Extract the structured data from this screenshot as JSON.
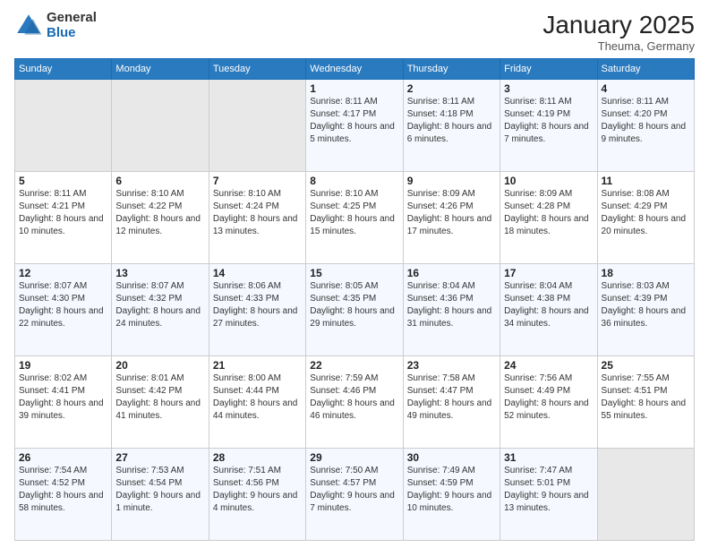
{
  "header": {
    "logo_general": "General",
    "logo_blue": "Blue",
    "month_title": "January 2025",
    "location": "Theuma, Germany"
  },
  "weekdays": [
    "Sunday",
    "Monday",
    "Tuesday",
    "Wednesday",
    "Thursday",
    "Friday",
    "Saturday"
  ],
  "weeks": [
    [
      {
        "day": "",
        "info": ""
      },
      {
        "day": "",
        "info": ""
      },
      {
        "day": "",
        "info": ""
      },
      {
        "day": "1",
        "info": "Sunrise: 8:11 AM\nSunset: 4:17 PM\nDaylight: 8 hours and 5 minutes."
      },
      {
        "day": "2",
        "info": "Sunrise: 8:11 AM\nSunset: 4:18 PM\nDaylight: 8 hours and 6 minutes."
      },
      {
        "day": "3",
        "info": "Sunrise: 8:11 AM\nSunset: 4:19 PM\nDaylight: 8 hours and 7 minutes."
      },
      {
        "day": "4",
        "info": "Sunrise: 8:11 AM\nSunset: 4:20 PM\nDaylight: 8 hours and 9 minutes."
      }
    ],
    [
      {
        "day": "5",
        "info": "Sunrise: 8:11 AM\nSunset: 4:21 PM\nDaylight: 8 hours and 10 minutes."
      },
      {
        "day": "6",
        "info": "Sunrise: 8:10 AM\nSunset: 4:22 PM\nDaylight: 8 hours and 12 minutes."
      },
      {
        "day": "7",
        "info": "Sunrise: 8:10 AM\nSunset: 4:24 PM\nDaylight: 8 hours and 13 minutes."
      },
      {
        "day": "8",
        "info": "Sunrise: 8:10 AM\nSunset: 4:25 PM\nDaylight: 8 hours and 15 minutes."
      },
      {
        "day": "9",
        "info": "Sunrise: 8:09 AM\nSunset: 4:26 PM\nDaylight: 8 hours and 17 minutes."
      },
      {
        "day": "10",
        "info": "Sunrise: 8:09 AM\nSunset: 4:28 PM\nDaylight: 8 hours and 18 minutes."
      },
      {
        "day": "11",
        "info": "Sunrise: 8:08 AM\nSunset: 4:29 PM\nDaylight: 8 hours and 20 minutes."
      }
    ],
    [
      {
        "day": "12",
        "info": "Sunrise: 8:07 AM\nSunset: 4:30 PM\nDaylight: 8 hours and 22 minutes."
      },
      {
        "day": "13",
        "info": "Sunrise: 8:07 AM\nSunset: 4:32 PM\nDaylight: 8 hours and 24 minutes."
      },
      {
        "day": "14",
        "info": "Sunrise: 8:06 AM\nSunset: 4:33 PM\nDaylight: 8 hours and 27 minutes."
      },
      {
        "day": "15",
        "info": "Sunrise: 8:05 AM\nSunset: 4:35 PM\nDaylight: 8 hours and 29 minutes."
      },
      {
        "day": "16",
        "info": "Sunrise: 8:04 AM\nSunset: 4:36 PM\nDaylight: 8 hours and 31 minutes."
      },
      {
        "day": "17",
        "info": "Sunrise: 8:04 AM\nSunset: 4:38 PM\nDaylight: 8 hours and 34 minutes."
      },
      {
        "day": "18",
        "info": "Sunrise: 8:03 AM\nSunset: 4:39 PM\nDaylight: 8 hours and 36 minutes."
      }
    ],
    [
      {
        "day": "19",
        "info": "Sunrise: 8:02 AM\nSunset: 4:41 PM\nDaylight: 8 hours and 39 minutes."
      },
      {
        "day": "20",
        "info": "Sunrise: 8:01 AM\nSunset: 4:42 PM\nDaylight: 8 hours and 41 minutes."
      },
      {
        "day": "21",
        "info": "Sunrise: 8:00 AM\nSunset: 4:44 PM\nDaylight: 8 hours and 44 minutes."
      },
      {
        "day": "22",
        "info": "Sunrise: 7:59 AM\nSunset: 4:46 PM\nDaylight: 8 hours and 46 minutes."
      },
      {
        "day": "23",
        "info": "Sunrise: 7:58 AM\nSunset: 4:47 PM\nDaylight: 8 hours and 49 minutes."
      },
      {
        "day": "24",
        "info": "Sunrise: 7:56 AM\nSunset: 4:49 PM\nDaylight: 8 hours and 52 minutes."
      },
      {
        "day": "25",
        "info": "Sunrise: 7:55 AM\nSunset: 4:51 PM\nDaylight: 8 hours and 55 minutes."
      }
    ],
    [
      {
        "day": "26",
        "info": "Sunrise: 7:54 AM\nSunset: 4:52 PM\nDaylight: 8 hours and 58 minutes."
      },
      {
        "day": "27",
        "info": "Sunrise: 7:53 AM\nSunset: 4:54 PM\nDaylight: 9 hours and 1 minute."
      },
      {
        "day": "28",
        "info": "Sunrise: 7:51 AM\nSunset: 4:56 PM\nDaylight: 9 hours and 4 minutes."
      },
      {
        "day": "29",
        "info": "Sunrise: 7:50 AM\nSunset: 4:57 PM\nDaylight: 9 hours and 7 minutes."
      },
      {
        "day": "30",
        "info": "Sunrise: 7:49 AM\nSunset: 4:59 PM\nDaylight: 9 hours and 10 minutes."
      },
      {
        "day": "31",
        "info": "Sunrise: 7:47 AM\nSunset: 5:01 PM\nDaylight: 9 hours and 13 minutes."
      },
      {
        "day": "",
        "info": ""
      }
    ]
  ]
}
